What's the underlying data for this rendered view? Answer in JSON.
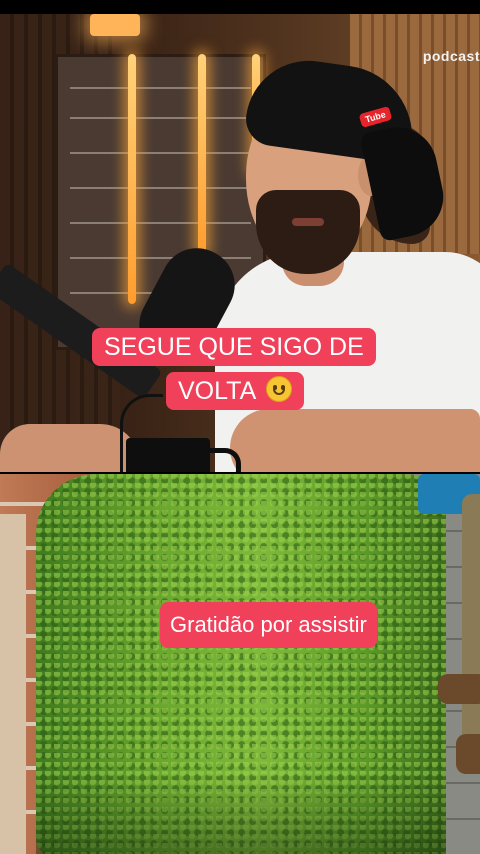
{
  "watermark": "podcast",
  "cap_logo": "Tube",
  "captions": {
    "line1": "SEGUE QUE SIGO DE",
    "line2": "VOLTA",
    "line2_emoji": "slightly-smiling-face",
    "bottom": "Gratidão por assistir"
  },
  "colors": {
    "caption_bg": "#f0405a",
    "caption_text": "#ffffff"
  }
}
